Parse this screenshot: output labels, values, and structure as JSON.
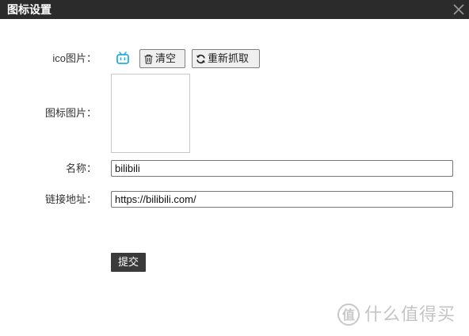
{
  "dialog": {
    "title": "图标设置"
  },
  "form": {
    "ico_label": "ico图片：",
    "icon_image_label": "图标图片：",
    "name_label": "名称：",
    "url_label": "链接地址：",
    "name_value": "bilibili",
    "url_value": "https://bilibili.com/"
  },
  "buttons": {
    "clear_label": "清空",
    "refetch_label": "重新抓取",
    "submit_label": "提交"
  },
  "icons": {
    "favicon": "bilibili-tv-icon",
    "clear": "trash-icon",
    "refetch": "refresh-icon",
    "close": "close-icon"
  },
  "colors": {
    "titlebar": "#2b2b2b",
    "favicon": "#23ade5",
    "submit_bg": "#3a3a3a"
  },
  "watermark": {
    "text": "什么值得买"
  }
}
